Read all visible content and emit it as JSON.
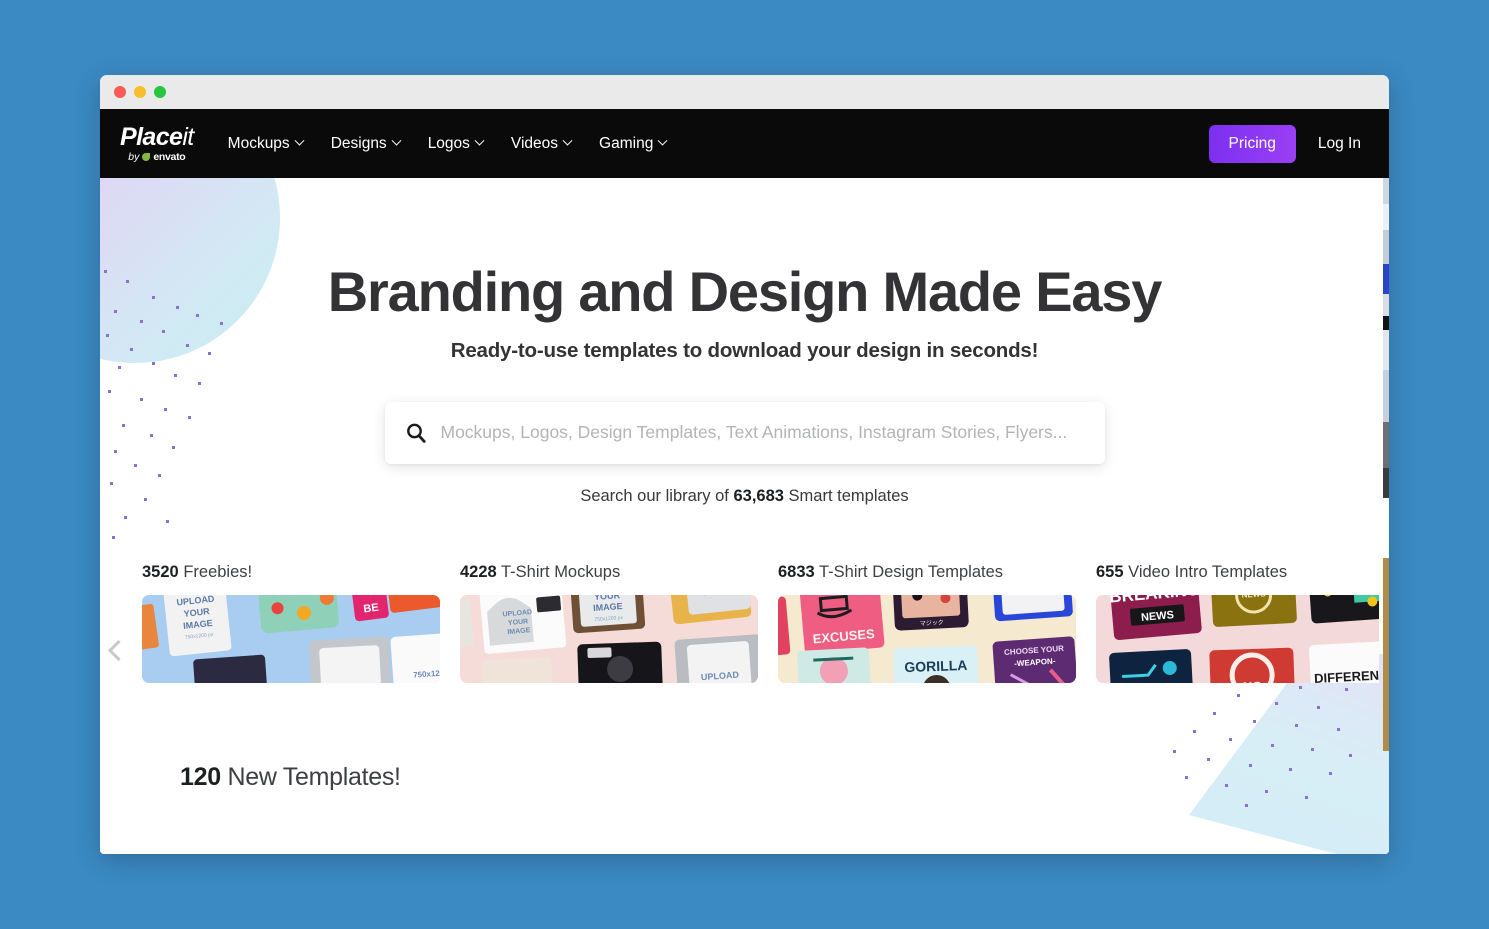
{
  "window": {
    "traffic_lights": [
      "close",
      "minimize",
      "maximize"
    ]
  },
  "nav": {
    "logo": {
      "main": "Place",
      "main_italic": "it",
      "by": "by",
      "brand": "envato"
    },
    "items": [
      {
        "label": "Mockups",
        "has_dropdown": true
      },
      {
        "label": "Designs",
        "has_dropdown": true
      },
      {
        "label": "Logos",
        "has_dropdown": true
      },
      {
        "label": "Videos",
        "has_dropdown": true
      },
      {
        "label": "Gaming",
        "has_dropdown": true
      }
    ],
    "pricing_label": "Pricing",
    "login_label": "Log In",
    "background": "#0a0a0a",
    "pricing_color": "#8a33f2"
  },
  "hero": {
    "title": "Branding and Design Made Easy",
    "subtitle": "Ready-to-use templates to download your design in seconds!"
  },
  "search": {
    "placeholder": "Mockups, Logos, Design Templates, Text Animations, Instagram Stories, Flyers...",
    "value": "",
    "icon": "search-icon"
  },
  "library_line": {
    "prefix": "Search our library of",
    "count": "63,683",
    "suffix": "Smart templates"
  },
  "carousel": {
    "prev_icon": "chevron-left-icon",
    "next_icon": "chevron-right-icon",
    "cards": [
      {
        "count": "3520",
        "label": "Freebies!",
        "thumb_bg": "#a9cdf0",
        "thumb_name": "freebies-thumbnail"
      },
      {
        "count": "4228",
        "label": "T-Shirt Mockups",
        "thumb_bg": "#f6dcd8",
        "thumb_name": "tshirt-mockups-thumbnail"
      },
      {
        "count": "6833",
        "label": "T-Shirt Design Templates",
        "thumb_bg": "#f5e9cf",
        "thumb_name": "tshirt-designs-thumbnail"
      },
      {
        "count": "655",
        "label": "Video Intro Templates",
        "thumb_bg": "#f4d9da",
        "thumb_name": "video-intro-thumbnail"
      }
    ]
  },
  "new_templates": {
    "count": "120",
    "label": "New Templates!"
  },
  "colors": {
    "page_background": "#3b8ac4",
    "accent_purple": "#8a33f2",
    "text_dark": "#333335"
  }
}
